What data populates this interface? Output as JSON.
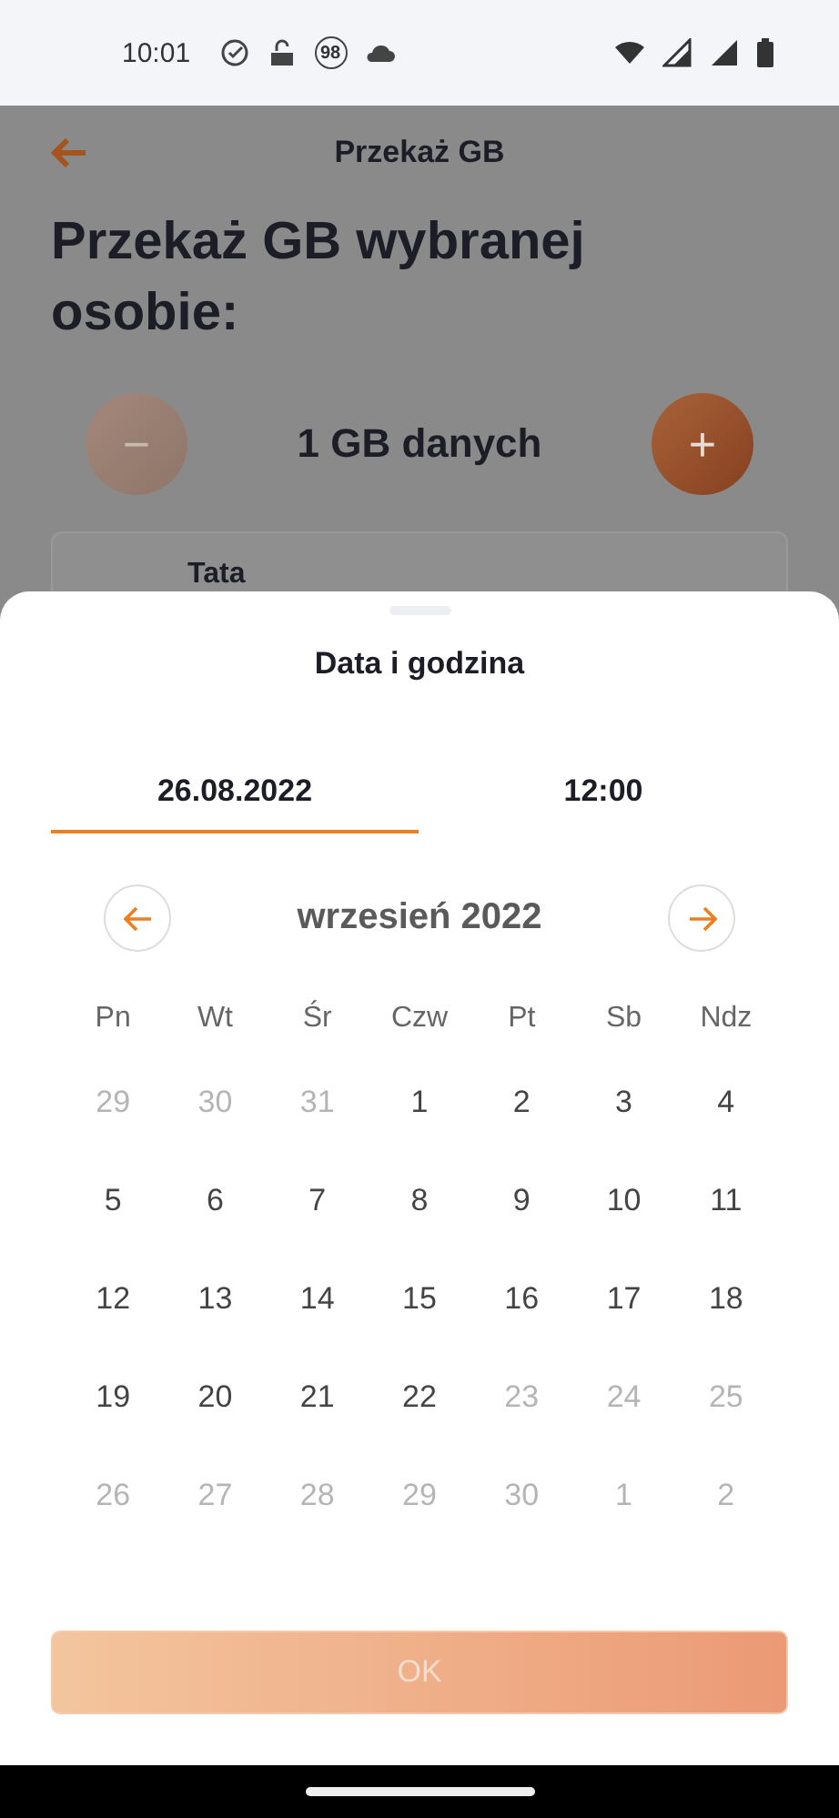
{
  "status_bar": {
    "time": "10:01",
    "badge": "98"
  },
  "page": {
    "title": "Przekaż GB",
    "heading": "Przekaż GB wybranej osobie:",
    "amount": "1 GB danych",
    "minus": {
      "label": "−",
      "disabled": true
    },
    "plus": {
      "label": "+",
      "disabled": false
    },
    "recipient": "Tata"
  },
  "sheet": {
    "title": "Data i godzina",
    "tabs": [
      {
        "label": "26.08.2022",
        "selected": true
      },
      {
        "label": "12:00",
        "selected": false
      }
    ],
    "month": "wrzesień 2022",
    "weekdays": [
      "Pn",
      "Wt",
      "Śr",
      "Czw",
      "Pt",
      "Sb",
      "Ndz"
    ],
    "days": [
      {
        "label": "29",
        "disabled": true
      },
      {
        "label": "30",
        "disabled": true
      },
      {
        "label": "31",
        "disabled": true
      },
      {
        "label": "1",
        "disabled": false
      },
      {
        "label": "2",
        "disabled": false
      },
      {
        "label": "3",
        "disabled": false
      },
      {
        "label": "4",
        "disabled": false
      },
      {
        "label": "5",
        "disabled": false
      },
      {
        "label": "6",
        "disabled": false
      },
      {
        "label": "7",
        "disabled": false
      },
      {
        "label": "8",
        "disabled": false
      },
      {
        "label": "9",
        "disabled": false
      },
      {
        "label": "10",
        "disabled": false
      },
      {
        "label": "11",
        "disabled": false
      },
      {
        "label": "12",
        "disabled": false
      },
      {
        "label": "13",
        "disabled": false
      },
      {
        "label": "14",
        "disabled": false
      },
      {
        "label": "15",
        "disabled": false
      },
      {
        "label": "16",
        "disabled": false
      },
      {
        "label": "17",
        "disabled": false
      },
      {
        "label": "18",
        "disabled": false
      },
      {
        "label": "19",
        "disabled": false
      },
      {
        "label": "20",
        "disabled": false
      },
      {
        "label": "21",
        "disabled": false
      },
      {
        "label": "22",
        "disabled": false
      },
      {
        "label": "23",
        "disabled": true
      },
      {
        "label": "24",
        "disabled": true
      },
      {
        "label": "25",
        "disabled": true
      },
      {
        "label": "26",
        "disabled": true
      },
      {
        "label": "27",
        "disabled": true
      },
      {
        "label": "28",
        "disabled": true
      },
      {
        "label": "29",
        "disabled": true
      },
      {
        "label": "30",
        "disabled": true
      },
      {
        "label": "1",
        "disabled": true
      },
      {
        "label": "2",
        "disabled": true
      }
    ],
    "ok": {
      "label": "OK",
      "disabled": true
    }
  }
}
